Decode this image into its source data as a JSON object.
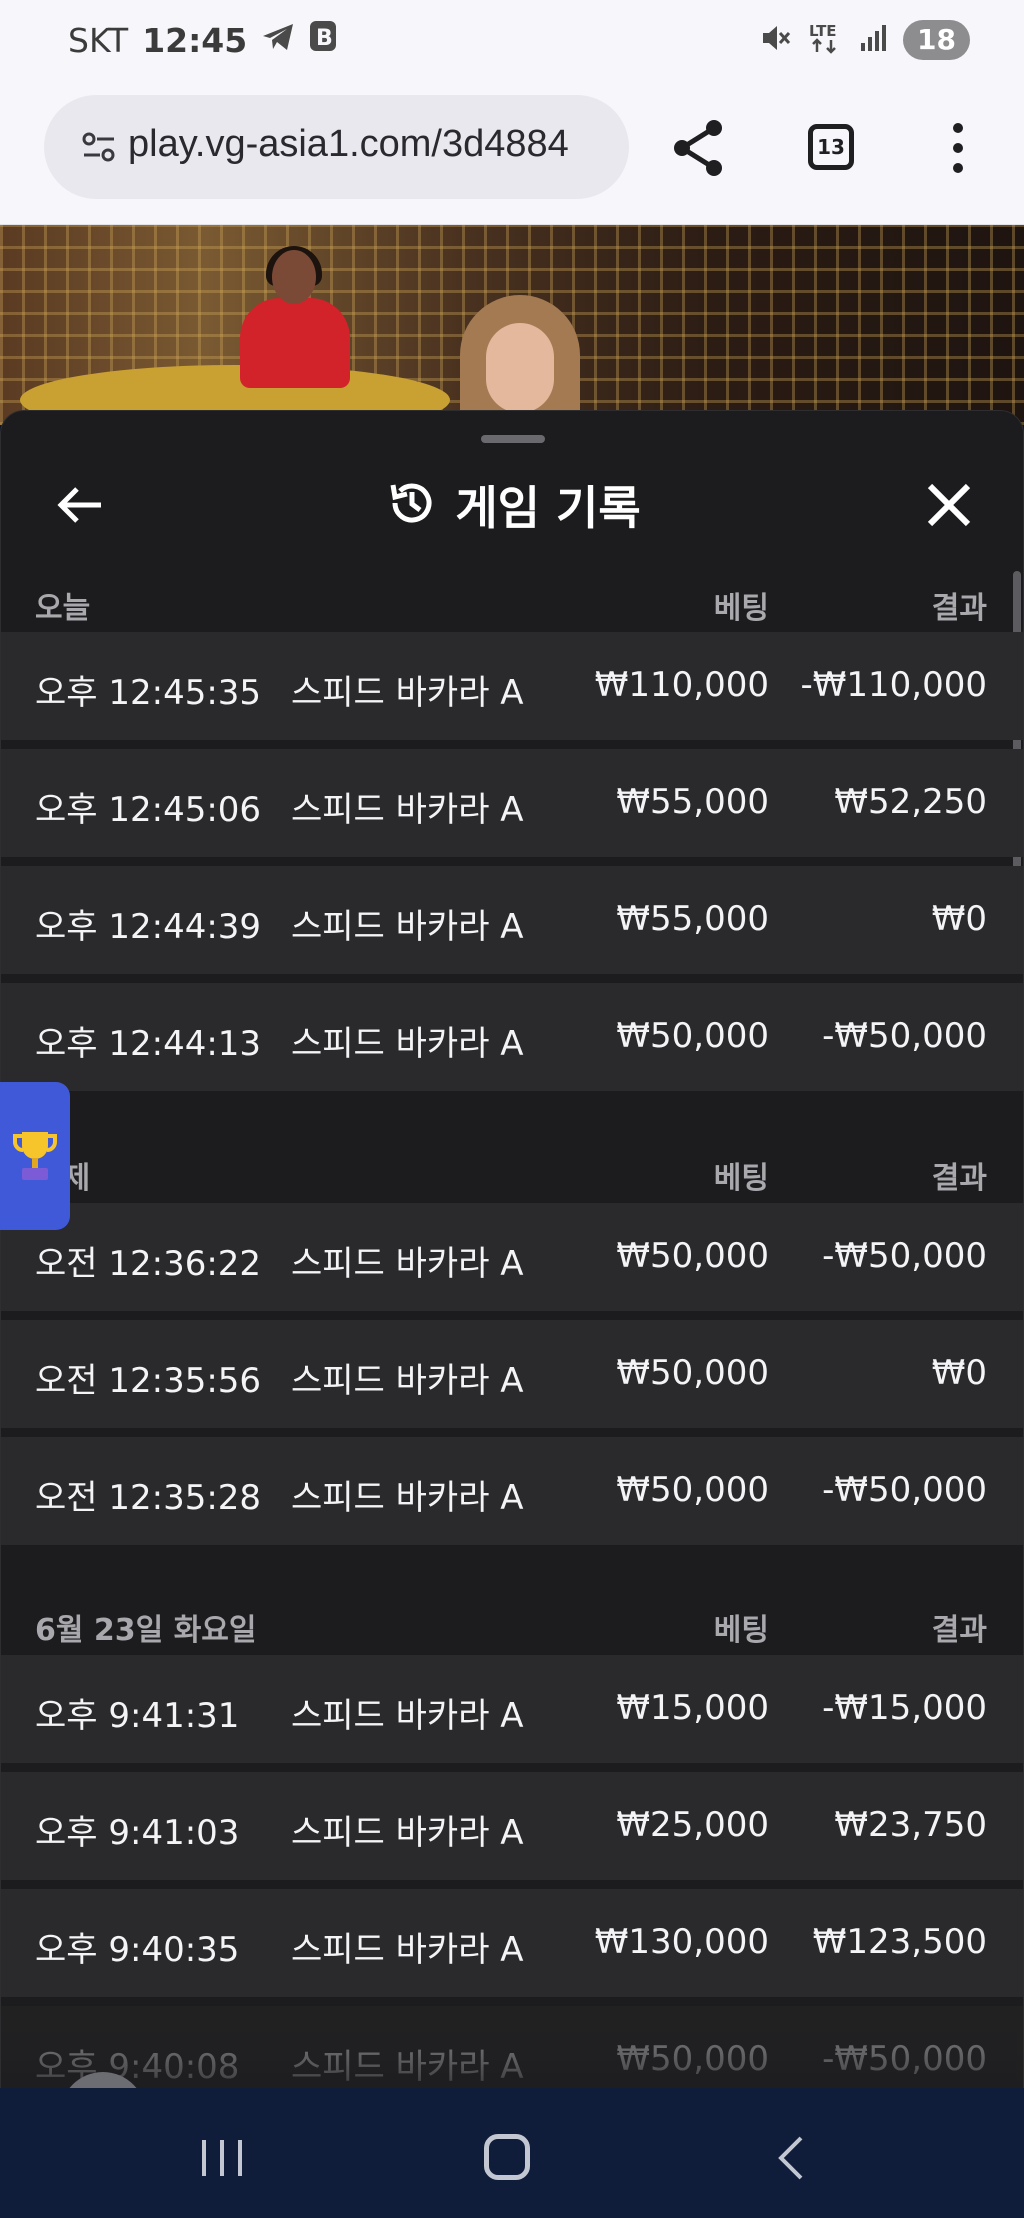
{
  "status_bar": {
    "carrier": "SKT",
    "time": "12:45",
    "battery": "18",
    "network": "LTE"
  },
  "browser": {
    "url": "play.vg-asia1.com/3d4884",
    "tab_count": "13"
  },
  "panel": {
    "title": "게임 기록",
    "sections": [
      {
        "label": "오늘",
        "bet_header": "베팅",
        "result_header": "결과",
        "rows": [
          {
            "time": "오후 12:45:35",
            "game": "스피드 바카라 A",
            "bet": "₩110,000",
            "result": "-₩110,000"
          },
          {
            "time": "오후 12:45:06",
            "game": "스피드 바카라 A",
            "bet": "₩55,000",
            "result": "₩52,250"
          },
          {
            "time": "오후 12:44:39",
            "game": "스피드 바카라 A",
            "bet": "₩55,000",
            "result": "₩0"
          },
          {
            "time": "오후 12:44:13",
            "game": "스피드 바카라 A",
            "bet": "₩50,000",
            "result": "-₩50,000"
          }
        ]
      },
      {
        "label": "어제",
        "bet_header": "베팅",
        "result_header": "결과",
        "rows": [
          {
            "time": "오전 12:36:22",
            "game": "스피드 바카라 A",
            "bet": "₩50,000",
            "result": "-₩50,000"
          },
          {
            "time": "오전 12:35:56",
            "game": "스피드 바카라 A",
            "bet": "₩50,000",
            "result": "₩0"
          },
          {
            "time": "오전 12:35:28",
            "game": "스피드 바카라 A",
            "bet": "₩50,000",
            "result": "-₩50,000"
          }
        ]
      },
      {
        "label": "6월 23일 화요일",
        "bet_header": "베팅",
        "result_header": "결과",
        "rows": [
          {
            "time": "오후 9:41:31",
            "game": "스피드 바카라 A",
            "bet": "₩15,000",
            "result": "-₩15,000"
          },
          {
            "time": "오후 9:41:03",
            "game": "스피드 바카라 A",
            "bet": "₩25,000",
            "result": "₩23,750"
          },
          {
            "time": "오후 9:40:35",
            "game": "스피드 바카라 A",
            "bet": "₩130,000",
            "result": "₩123,500"
          },
          {
            "time": "오후 9:40:08",
            "game": "스피드 바카라 A",
            "bet": "₩50,000",
            "result": "-₩50,000"
          }
        ]
      }
    ]
  }
}
